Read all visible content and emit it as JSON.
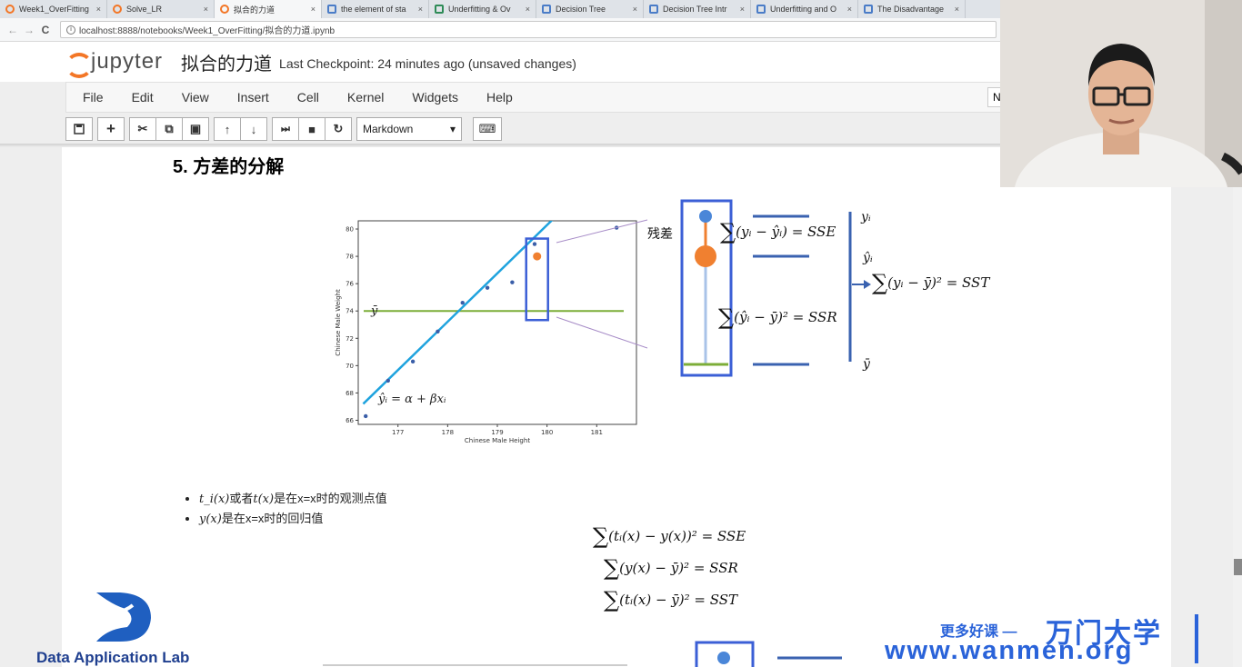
{
  "browser": {
    "tabs": [
      {
        "label": "Week1_OverFitting",
        "active": false
      },
      {
        "label": "Solve_LR",
        "active": false
      },
      {
        "label": "拟合的力道",
        "active": true
      },
      {
        "label": "the element of sta",
        "active": false
      },
      {
        "label": "Underfitting & Ov",
        "active": false
      },
      {
        "label": "Decision Tree",
        "active": false
      },
      {
        "label": "Decision Tree Intr",
        "active": false
      },
      {
        "label": "Underfitting and O",
        "active": false
      },
      {
        "label": "The Disadvantage",
        "active": false
      }
    ],
    "close_glyph": "×",
    "back_glyph": "←",
    "forward_glyph": "→",
    "reload_glyph": "C",
    "info_glyph": "i",
    "url": "localhost:8888/notebooks/Week1_OverFitting/拟合的力道.ipynb"
  },
  "jupyter": {
    "logo_text": "jupyter",
    "notebook_name": "拟合的力道",
    "checkpoint": "Last Checkpoint: 24 minutes ago (unsaved changes)",
    "menu": [
      "File",
      "Edit",
      "View",
      "Insert",
      "Cell",
      "Kernel",
      "Widgets",
      "Help"
    ],
    "kernel_indicator": "N",
    "toolbar": {
      "save_icon": "floppy-icon",
      "add_glyph": "+",
      "cut_glyph": "✂",
      "copy_glyph": "⧉",
      "paste_glyph": "▣",
      "up_glyph": "↑",
      "down_glyph": "↓",
      "run_glyph": "⏭",
      "stop_glyph": "■",
      "restart_glyph": "↻",
      "cell_type": "Markdown",
      "cell_type_arrow": "▾",
      "keyboard_glyph": "⌨"
    }
  },
  "content": {
    "section_title": "5. 方差的分解",
    "residual_label": "残差",
    "bullets": [
      {
        "math": "t_i(x)",
        "text_1": "或者",
        "math_2": "t(x)",
        "text_2": "是在x=x时的观测点值"
      },
      {
        "math": "y(x)",
        "text_1": "是在x=x时的回归值",
        "math_2": "",
        "text_2": ""
      }
    ],
    "right_equations": {
      "sse": "(yᵢ − ŷᵢ) = SSE",
      "ssr": "(ŷᵢ − ȳ)² = SSR",
      "sst": "(yᵢ − ȳ)² = SST",
      "y_i": "yᵢ",
      "y_hat": "ŷᵢ",
      "y_bar": "ȳ"
    },
    "bottom_equations": [
      "(tᵢ(x) − y(x))² = SSE",
      "(y(x) − ȳ)² = SSR",
      "(tᵢ(x) − ȳ)² = SST"
    ],
    "sum_glyph": "∑"
  },
  "chart_data": {
    "type": "scatter",
    "xlabel": "Chinese Male Height",
    "ylabel": "Chinese Male Weight",
    "xlim": [
      176.2,
      181.8
    ],
    "ylim": [
      65.7,
      80.6
    ],
    "xticks": [
      177,
      178,
      179,
      180,
      181
    ],
    "yticks": [
      66,
      68,
      70,
      72,
      74,
      76,
      78,
      80
    ],
    "points": [
      {
        "x": 176.35,
        "y": 66.3
      },
      {
        "x": 176.8,
        "y": 68.9
      },
      {
        "x": 177.3,
        "y": 70.3
      },
      {
        "x": 177.8,
        "y": 72.5
      },
      {
        "x": 178.3,
        "y": 74.6
      },
      {
        "x": 178.8,
        "y": 75.7
      },
      {
        "x": 179.3,
        "y": 76.1
      },
      {
        "x": 179.75,
        "y": 78.9
      },
      {
        "x": 181.4,
        "y": 80.1
      }
    ],
    "highlight_point": {
      "x": 179.8,
      "y": 78.0
    },
    "regression_line": {
      "x1": 176.3,
      "y1": 67.2,
      "x2": 180.2,
      "y2": 81.0
    },
    "mean_y": 74.0,
    "mean_label": "ȳ",
    "fit_label": "ŷᵢ = α + βxᵢ",
    "colors": {
      "fit": "#1fa3de",
      "mean": "#7cad38",
      "highlight": "#f08030",
      "points": "#3a5ea8",
      "box": "#3b5fd6"
    }
  },
  "branding": {
    "lab_name": "Data Application Lab",
    "promo_small": "更多好课 —",
    "promo_big": "万门大学",
    "promo_url": "www.wanmen.org"
  }
}
